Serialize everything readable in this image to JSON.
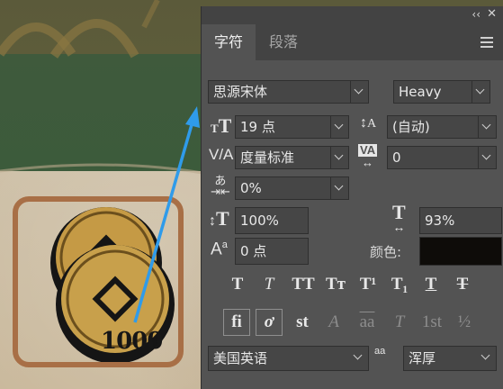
{
  "panel": {
    "tabs": [
      {
        "label": "字符"
      },
      {
        "label": "段落"
      }
    ]
  },
  "artwork": {
    "coin_value": "1000"
  },
  "font": {
    "family": "思源宋体",
    "style": "Heavy"
  },
  "size": {
    "font_size": "19 点",
    "leading": "(自动)"
  },
  "spacing": {
    "kerning": "度量标准",
    "tracking": "0",
    "tsume": "0%"
  },
  "scale": {
    "vertical": "100%",
    "horizontal": "93%",
    "baseline_shift": "0 点"
  },
  "color": {
    "label": "颜色:",
    "value": "#0e0c09"
  },
  "type_buttons": [
    {
      "name": "faux-bold",
      "glyph": "T"
    },
    {
      "name": "faux-italic",
      "glyph": "T"
    },
    {
      "name": "all-caps",
      "glyph": "TT"
    },
    {
      "name": "small-caps",
      "glyph": "Tт"
    },
    {
      "name": "superscript",
      "glyph": "T¹"
    },
    {
      "name": "subscript",
      "glyph": "T₁"
    },
    {
      "name": "underline",
      "glyph": "T"
    },
    {
      "name": "strikethrough",
      "glyph": "T"
    }
  ],
  "opentype_buttons": [
    {
      "name": "standard-ligatures",
      "glyph": "fi"
    },
    {
      "name": "contextual-alternates",
      "glyph": "ơ"
    },
    {
      "name": "discretionary-ligatures",
      "glyph": "st"
    },
    {
      "name": "swash",
      "glyph": "A"
    },
    {
      "name": "stylistic-alternates",
      "glyph": "aa"
    },
    {
      "name": "titling-alternates",
      "glyph": "T"
    },
    {
      "name": "ordinals",
      "glyph": "1st"
    },
    {
      "name": "fractions",
      "glyph": "½"
    }
  ],
  "language": {
    "value": "美国英语"
  },
  "antialias": {
    "icon_text": "aa",
    "value": "浑厚"
  }
}
